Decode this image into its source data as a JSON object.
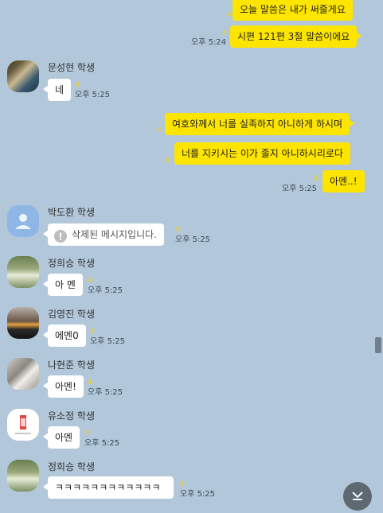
{
  "messages": {
    "m1": {
      "text": "오늘 말씀은 내가 써줄게요",
      "unread": "4"
    },
    "m2": {
      "text": "시편 121편 3절 말씀이에요",
      "unread": "4",
      "time": "오후 5:24"
    },
    "m3": {
      "sender": "문성현 학생",
      "text": "네",
      "unread": "4",
      "time": "오후 5:25"
    },
    "m4": {
      "text": "여호와께서 너를 실족하지 아니하게 하시며",
      "unread": "4"
    },
    "m5": {
      "text": "너를 지키시는 이가 졸지 아니하시리로다",
      "unread": "4"
    },
    "m6": {
      "text": "아멘..!",
      "unread": "4",
      "time": "오후 5:25"
    },
    "m7": {
      "sender": "박도환 학생",
      "text": "삭제된 메시지입니다.",
      "unread": "4",
      "time": "오후 5:25"
    },
    "m8": {
      "sender": "정희승 학생",
      "text": "아 멘",
      "unread": "4",
      "time": "오후 5:25"
    },
    "m9": {
      "sender": "김영진 학생",
      "text": "에멘0",
      "unread": "4",
      "time": "오후 5:25"
    },
    "m10": {
      "sender": "나현준 학생",
      "text": "아멘!",
      "unread": "4",
      "time": "오후 5:25"
    },
    "m11": {
      "sender": "유소정 학생",
      "text": "아멘",
      "unread": "4",
      "time": "오후 5:25"
    },
    "m12": {
      "sender": "정희승 학생",
      "text": "ㅋㅋㅋㅋㅋㅋㅋㅋㅋㅋㅋㅋ",
      "unread": "4",
      "time": "오후 5:25"
    }
  },
  "colors": {
    "background": "#b2c7d9",
    "my_bubble": "#fee500",
    "other_bubble": "#ffffff",
    "unread_count": "#f5cd1d"
  },
  "icons": {
    "deleted": "exclamation-circle-icon",
    "scroll_down": "chevron-down-icon"
  }
}
